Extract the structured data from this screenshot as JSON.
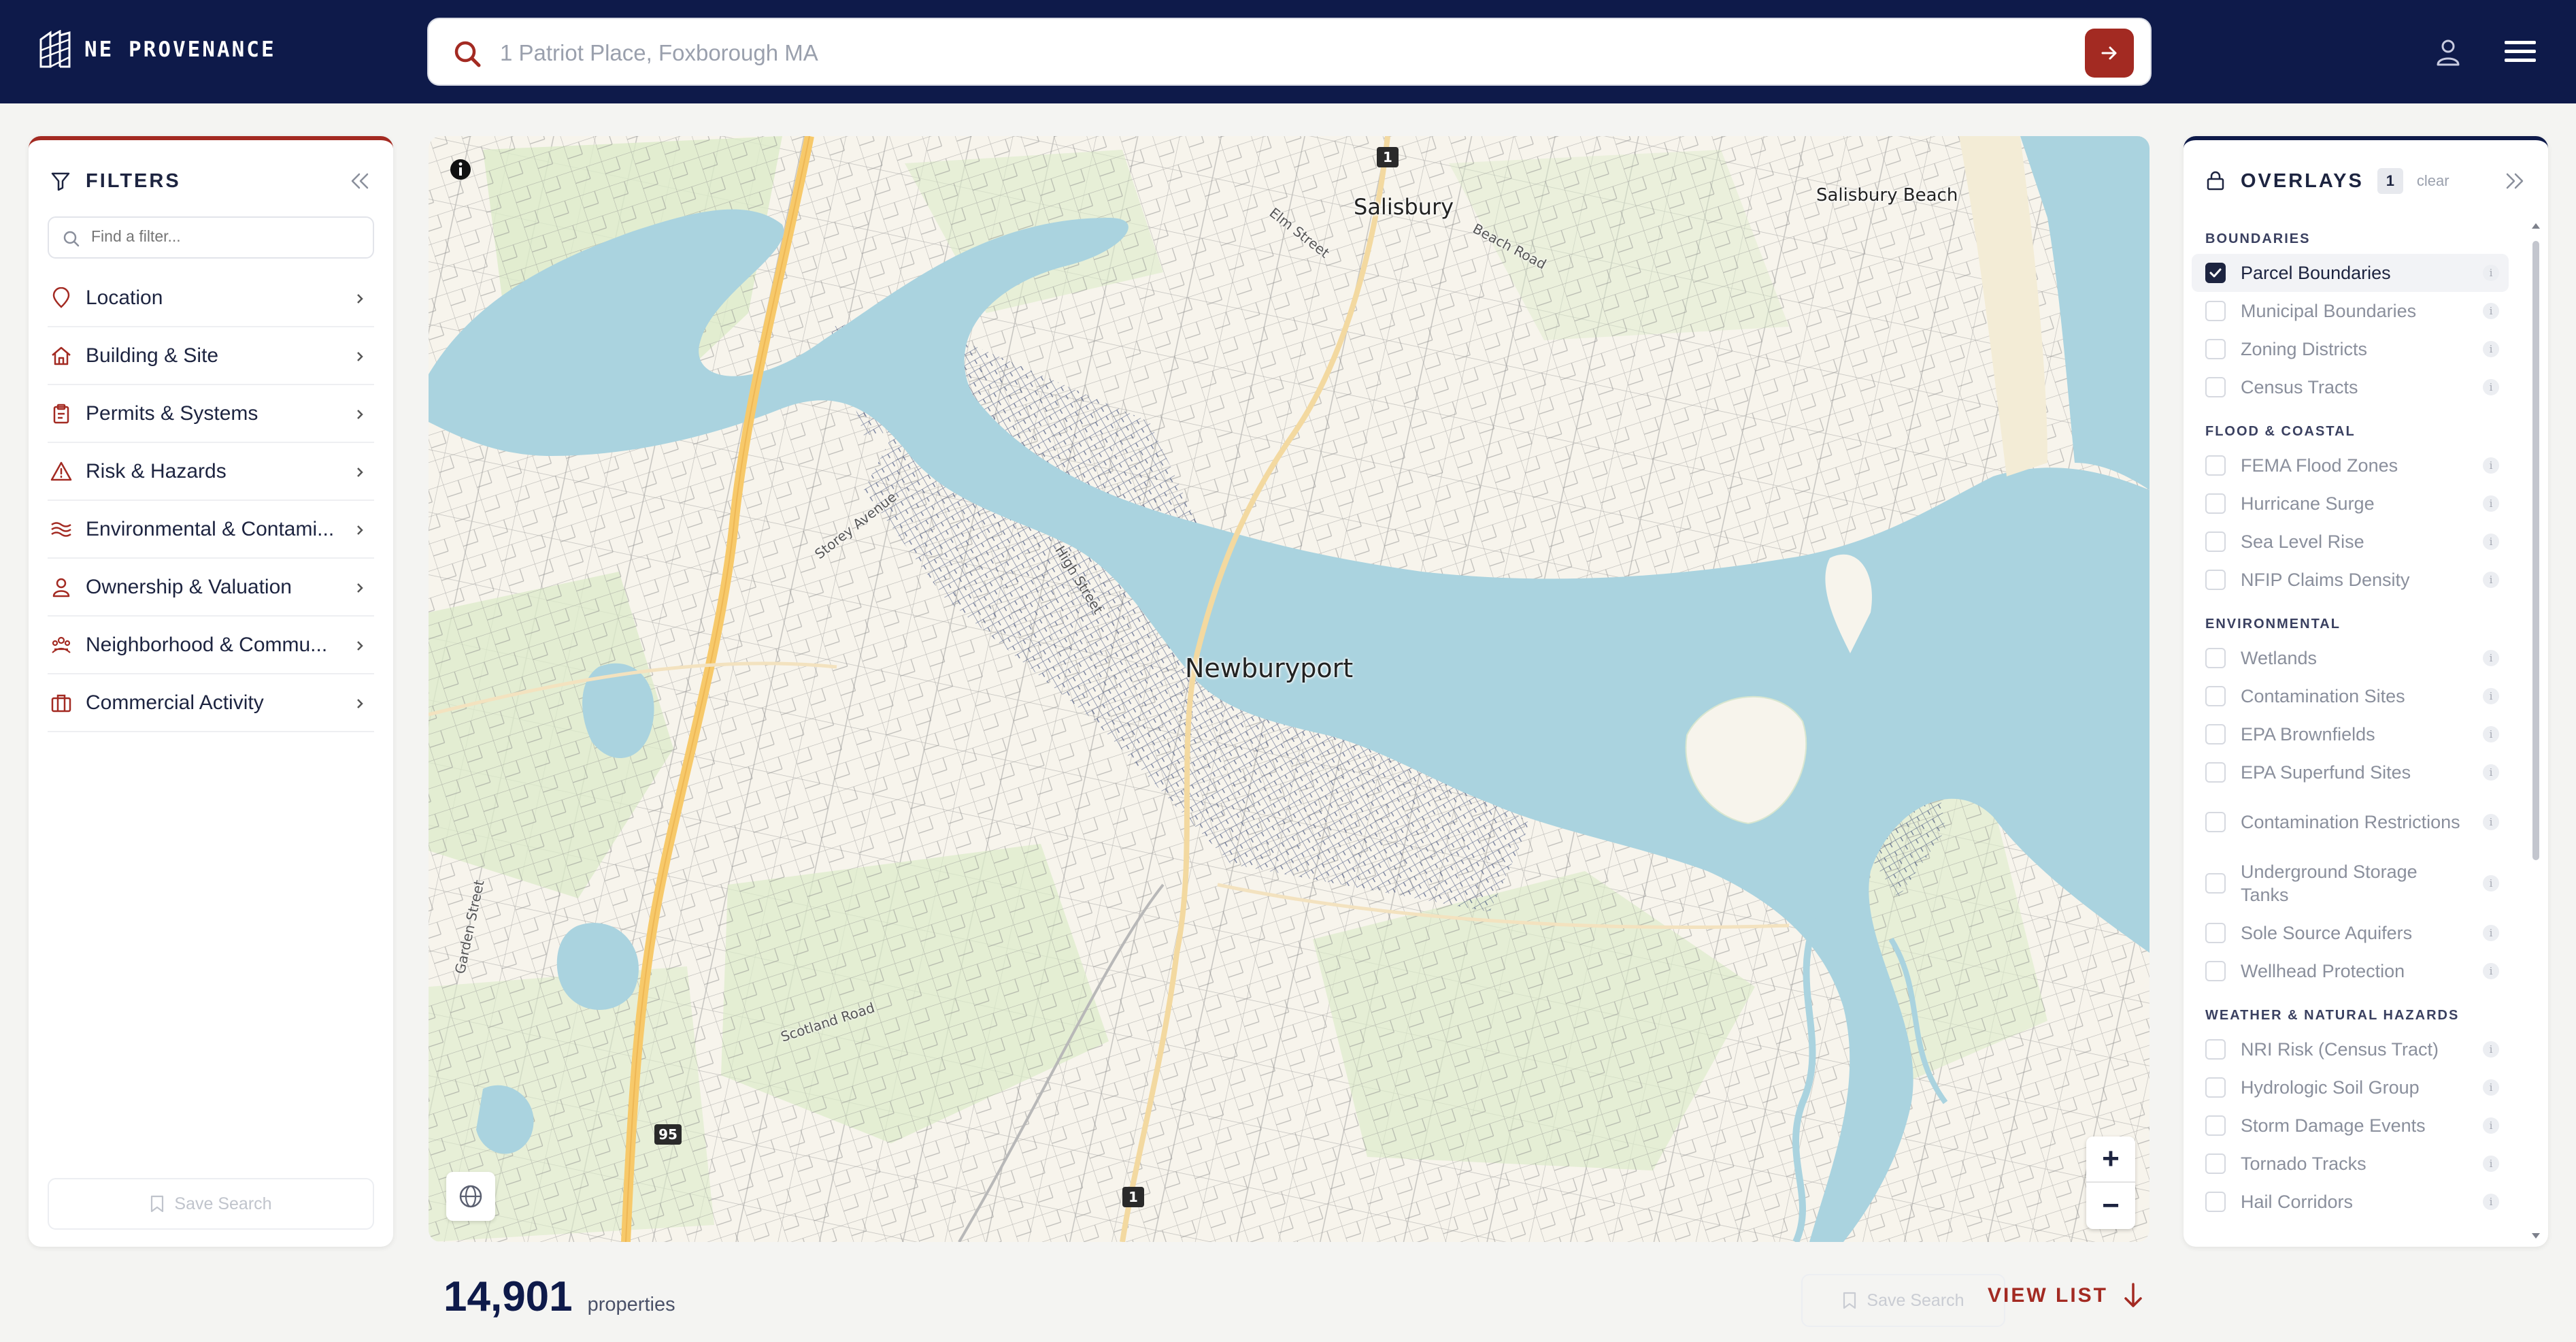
{
  "brand": {
    "name": "NE PROVENANCE"
  },
  "search": {
    "placeholder": "1 Patriot Place, Foxborough MA"
  },
  "filters": {
    "title": "FILTERS",
    "find_placeholder": "Find a filter...",
    "items": [
      {
        "label": "Location",
        "icon": "map-pin-icon"
      },
      {
        "label": "Building & Site",
        "icon": "home-icon"
      },
      {
        "label": "Permits & Systems",
        "icon": "clipboard-icon"
      },
      {
        "label": "Risk & Hazards",
        "icon": "warning-icon"
      },
      {
        "label": "Environmental & Contami...",
        "icon": "waves-icon"
      },
      {
        "label": "Ownership & Valuation",
        "icon": "person-icon"
      },
      {
        "label": "Neighborhood & Commu...",
        "icon": "community-icon"
      },
      {
        "label": "Commercial Activity",
        "icon": "briefcase-icon"
      }
    ],
    "save_search": "Save Search"
  },
  "map": {
    "places": {
      "newburyport": "Newburyport",
      "salisbury": "Salisbury",
      "salisbury_beach": "Salisbury Beach"
    },
    "roads": {
      "storey": "Storey Avenue",
      "high": "High Street",
      "elm": "Elm Street",
      "beach": "Beach Road",
      "scotland": "Scotland Road",
      "garden": "Garden Street"
    },
    "shields": {
      "rt1_north": "1",
      "rt1_south": "1",
      "i95": "95"
    },
    "zoom_in": "+",
    "zoom_out": "−"
  },
  "overlays": {
    "title": "OVERLAYS",
    "active_count": "1",
    "clear_label": "clear",
    "groups": [
      {
        "title": "BOUNDARIES",
        "items": [
          "Parcel Boundaries",
          "Municipal Boundaries",
          "Zoning Districts",
          "Census Tracts"
        ]
      },
      {
        "title": "FLOOD & COASTAL",
        "items": [
          "FEMA Flood Zones",
          "Hurricane Surge",
          "Sea Level Rise",
          "NFIP Claims Density"
        ]
      },
      {
        "title": "ENVIRONMENTAL",
        "items": [
          "Wetlands",
          "Contamination Sites",
          "EPA Brownfields",
          "EPA Superfund Sites",
          "Contamination Restrictions",
          "Underground Storage Tanks",
          "Sole Source Aquifers",
          "Wellhead Protection"
        ]
      },
      {
        "title": "WEATHER & NATURAL HAZARDS",
        "items": [
          "NRI Risk (Census Tract)",
          "Hydrologic Soil Group",
          "Storm Damage Events",
          "Tornado Tracks",
          "Hail Corridors"
        ]
      }
    ],
    "checked": [
      "Parcel Boundaries"
    ],
    "info_glyph": "i"
  },
  "results": {
    "count": "14,901",
    "unit": "properties",
    "save_search": "Save Search",
    "view_list": "VIEW LIST"
  },
  "colors": {
    "navy": "#0e1a4a",
    "accent": "#a32a22",
    "water": "#aad3df",
    "land": "#f7f4ec",
    "park": "#dcebc9",
    "highway": "#f7c96a"
  }
}
